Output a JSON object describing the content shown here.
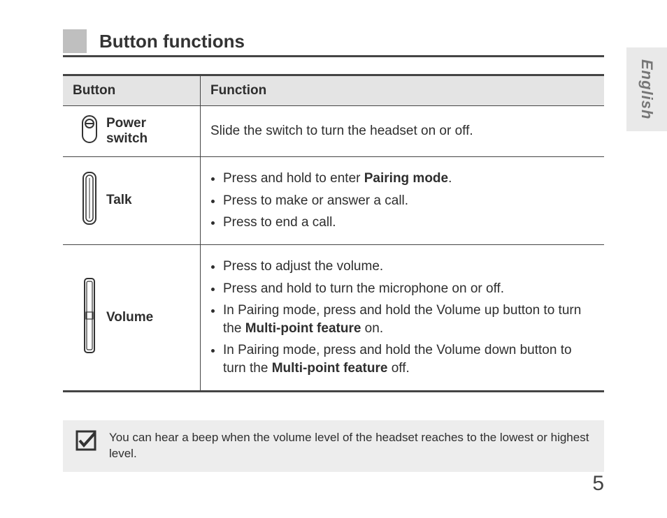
{
  "language_tab": "English",
  "heading": "Button functions",
  "table": {
    "header_button": "Button",
    "header_function": "Function"
  },
  "rows": {
    "power": {
      "label": "Power switch",
      "desc": "Slide the switch to turn the headset on or off."
    },
    "talk": {
      "label": "Talk",
      "b1a": "Press and hold to enter ",
      "b1b": "Pairing mode",
      "b1c": ".",
      "b2": "Press to make or answer a call.",
      "b3": "Press to end a call."
    },
    "volume": {
      "label": "Volume",
      "b1": "Press to adjust the volume.",
      "b2": "Press and hold to turn the microphone on or off.",
      "b3a": "In Pairing mode, press and hold the Volume up button to turn the ",
      "b3b": "Multi-point feature",
      "b3c": " on.",
      "b4a": "In Pairing mode, press and hold the Volume down button to turn the ",
      "b4b": "Multi-point feature",
      "b4c": " off."
    }
  },
  "note": "You can hear a beep when the volume level of the headset reaches to the lowest or highest level.",
  "page_number": "5"
}
